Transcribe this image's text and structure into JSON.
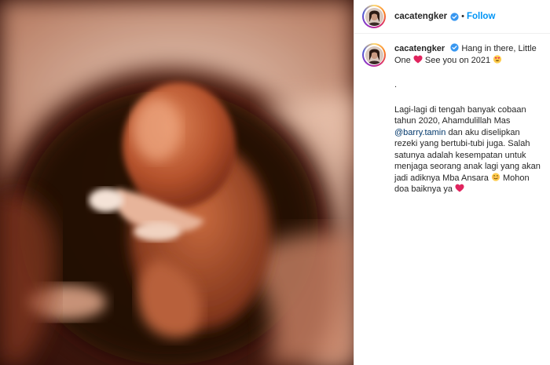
{
  "post": {
    "username": "cacatengker",
    "follow_label": "Follow",
    "separator": "•"
  },
  "icons": {
    "verified": "verified-badge-icon",
    "heart": "red-heart-emoji-icon",
    "heart_eyes": "heart-eyes-emoji-icon",
    "smile": "smiling-emoji-icon"
  },
  "colors": {
    "follow": "#0095f6",
    "verified": "#3897f0",
    "text": "#262626",
    "mention": "#00376b"
  },
  "caption": {
    "username": "cacatengker",
    "line1_text": "Hang in there, Little",
    "line2_text": "One",
    "line2_after_heart": "See you on 2021",
    "dot_line": ".",
    "p1": "Lagi-lagi di tengah banyak cobaan",
    "p2": "tahun 2020, Ahamdulillah Mas",
    "mention": "@barry.tamin",
    "p3_after_mention": "dan aku diselipkan",
    "p4": "rezeki yang bertubi-tubi juga. Salah",
    "p5": "satunya adalah kesempatan untuk",
    "p6": "menjaga seorang anak lagi yang akan",
    "p7_before_emoji": "jadi adiknya Mba Ansara",
    "p7_after_emoji": "Mohon",
    "p8": "doa baiknya ya"
  }
}
